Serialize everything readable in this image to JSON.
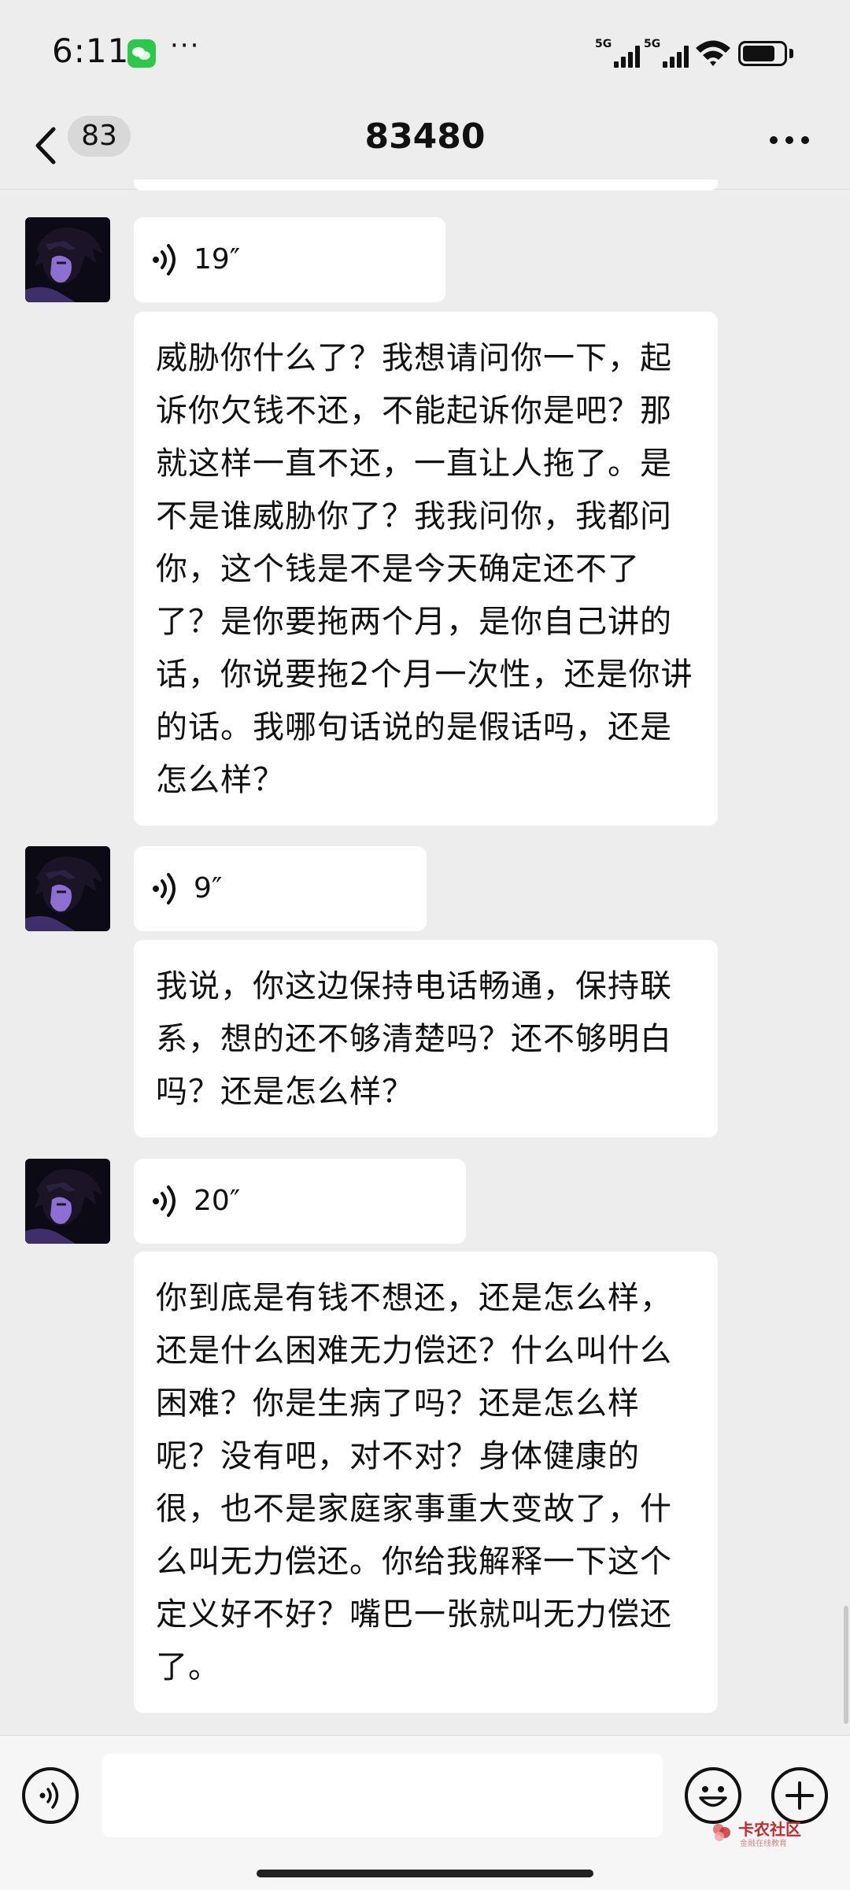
{
  "status_bar": {
    "time": "6:11",
    "more": "···",
    "network_1": "5G",
    "network_2": "5G",
    "battery_level": 0.8
  },
  "nav": {
    "unread_count": "83",
    "title": "83480"
  },
  "messages": [
    {
      "type": "voice",
      "duration": "19″"
    },
    {
      "type": "text",
      "text": "威胁你什么了？我想请问你一下，起诉你欠钱不还，不能起诉你是吧？那就这样一直不还，一直让人拖了。是不是谁威胁你了？我我问你，我都问你，这个钱是不是今天确定还不了了？是你要拖两个月，是你自己讲的话，你说要拖2个月一次性，还是你讲的话。我哪句话说的是假话吗，还是怎么样？"
    },
    {
      "type": "voice",
      "duration": "9″"
    },
    {
      "type": "text",
      "text": "我说，你这边保持电话畅通，保持联系，想的还不够清楚吗？还不够明白吗？还是怎么样？"
    },
    {
      "type": "voice",
      "duration": "20″"
    },
    {
      "type": "text",
      "text": "你到底是有钱不想还，还是怎么样，还是什么困难无力偿还？什么叫什么困难？你是生病了吗？还是怎么样呢？没有吧，对不对？身体健康的很，也不是家庭家事重大变故了，什么叫无力偿还。你给我解释一下这个定义好不好？嘴巴一张就叫无力偿还了。"
    }
  ],
  "watermark": {
    "name": "卡农社区",
    "sub": "金融在线教育"
  },
  "colors": {
    "background": "#ededed",
    "bubble": "#ffffff",
    "input_bar": "#f6f6f6"
  }
}
